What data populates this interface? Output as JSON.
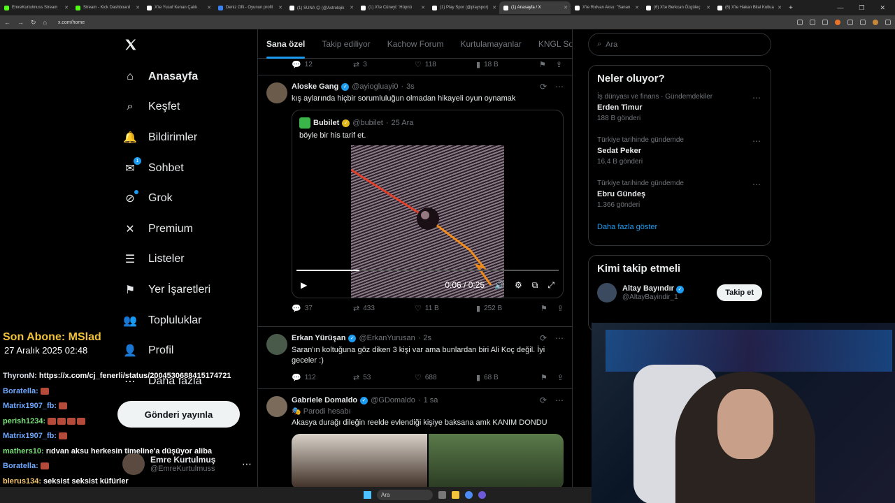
{
  "browser": {
    "tabs": [
      {
        "label": "EmreKurtulmuss Stream",
        "color": "#53fc18",
        "active": false
      },
      {
        "label": "Stream - Kick Dashboard",
        "color": "#53fc18",
        "active": false
      },
      {
        "label": "X'te Yusuf Kenan Çalık",
        "color": "#ffffff",
        "active": false
      },
      {
        "label": "Deniz Ofli - Oyunun profil",
        "color": "#3b82f6",
        "active": false
      },
      {
        "label": "(1) SUNA 😊 (@Astrolojik",
        "color": "#ffffff",
        "active": false
      },
      {
        "label": "(1) X'te Cüneyt: 'Hüpnü",
        "color": "#ffffff",
        "active": false
      },
      {
        "label": "(1) Play Spor (@playspor)",
        "color": "#ffffff",
        "active": false
      },
      {
        "label": "(1) Anasayfa / X",
        "color": "#ffffff",
        "active": true
      },
      {
        "label": "X'te Rıdvan Aksu: \"Sanan",
        "color": "#ffffff",
        "active": false
      },
      {
        "label": "(6) X'te Berkcan Özgüleç",
        "color": "#ffffff",
        "active": false
      },
      {
        "label": "(6) X'te Hakan Bilal Kutlua",
        "color": "#ffffff",
        "active": false
      }
    ],
    "url": "x.com/home"
  },
  "sidebar": {
    "items": [
      {
        "label": "Anasayfa",
        "icon": "home-icon",
        "bold": true
      },
      {
        "label": "Keşfet",
        "icon": "search-icon",
        "bold": false
      },
      {
        "label": "Bildirimler",
        "icon": "bell-icon",
        "bold": false
      },
      {
        "label": "Sohbet",
        "icon": "mail-icon",
        "bold": false,
        "badge": "1"
      },
      {
        "label": "Grok",
        "icon": "grok-icon",
        "bold": false
      },
      {
        "label": "Premium",
        "icon": "x-icon",
        "bold": false
      },
      {
        "label": "Listeler",
        "icon": "list-icon",
        "bold": false
      },
      {
        "label": "Yer İşaretleri",
        "icon": "bookmark-icon",
        "bold": false
      },
      {
        "label": "Topluluklar",
        "icon": "community-icon",
        "bold": false
      },
      {
        "label": "Profil",
        "icon": "person-icon",
        "bold": false
      },
      {
        "label": "Daha fazla",
        "icon": "more-icon",
        "bold": false
      }
    ],
    "post_button": "Gönderi yayınla",
    "account": {
      "name": "Emre Kurtulmuş",
      "handle": "@EmreKurtulmuss"
    }
  },
  "timeline": {
    "tabs": [
      "Sana özel",
      "Takip ediliyor",
      "Kachow Forum",
      "Kurtulamayanlar",
      "KNGL Soc"
    ],
    "prev_tweet_stats": {
      "replies": "12",
      "reposts": "3",
      "likes": "118",
      "views": "18 B"
    },
    "tweets": [
      {
        "name": "Aloske Gang",
        "handle": "@ayiogluayi0",
        "time": "3s",
        "text": "kış aylarında hiçbir sorumluluğun olmadan hikayeli oyun oynamak",
        "quote": {
          "name": "Bubilet",
          "handle": "@bubilet",
          "time": "25 Ara",
          "text": "böyle bir his tarif et.",
          "video_time": "0:06 / 0:25",
          "progress": 0.24
        },
        "stats": {
          "replies": "37",
          "reposts": "433",
          "likes": "11 B",
          "views": "252 B"
        }
      },
      {
        "name": "Erkan Yürüşan",
        "handle": "@ErkanYurusan",
        "time": "2s",
        "text": "Saran'ın koltuğuna göz diken 3 kişi var ama bunlardan biri Ali Koç değil. İyi geceler :)",
        "stats": {
          "replies": "112",
          "reposts": "53",
          "likes": "688",
          "views": "68 B"
        }
      },
      {
        "name": "Gabriele Domaldo",
        "handle": "@GDomaldo",
        "time": "1 sa",
        "parody": "Parodi hesabı",
        "text": "Akasya durağı dileğin reelde evlendiği kişiye baksana amk KANIM DONDU"
      }
    ]
  },
  "right": {
    "search_placeholder": "Ara",
    "trends_title": "Neler oluyor?",
    "trends": [
      {
        "category": "İş dünyası ve finans · Gündemdekiler",
        "title": "Erden Timur",
        "count": "188 B gönderi"
      },
      {
        "category": "Türkiye tarihinde gündemde",
        "title": "Sedat Peker",
        "count": "16,4 B gönderi"
      },
      {
        "category": "Türkiye tarihinde gündemde",
        "title": "Ebru Gündeş",
        "count": "1.366 gönderi"
      }
    ],
    "show_more": "Daha fazla göster",
    "who_title": "Kimi takip etmeli",
    "who": [
      {
        "name": "Altay Bayındır",
        "handle": "@AltayBayindir_1",
        "button": "Takip et"
      }
    ]
  },
  "overlay": {
    "title": "Son Abone: MSlad",
    "date": "27 Aralık 2025   02:48",
    "chat": [
      {
        "user": "ThyronN:",
        "msg": "https://x.com/cj_fenerli/status/2004530688415174721",
        "color": "#d7dde8"
      },
      {
        "user": "Boratella:",
        "msg": "",
        "color": "#6fa8ff",
        "emotes": 1
      },
      {
        "user": "Matrix1907_fb:",
        "msg": "",
        "color": "#6fa8ff",
        "emotes": 1
      },
      {
        "user": "perish1234:",
        "msg": "",
        "color": "#7be07b",
        "emotes": 4
      },
      {
        "user": "Matrix1907_fb:",
        "msg": "",
        "color": "#6fa8ff",
        "emotes": 1
      },
      {
        "user": "mathers10:",
        "msg": "rıdvan aksu herkesin timeline'a düşüyor aliba",
        "color": "#7be07b"
      },
      {
        "user": "Boratella:",
        "msg": "",
        "color": "#6fa8ff",
        "emotes": 1
      },
      {
        "user": "blerus134:",
        "msg": "seksist seksist küfürler",
        "color": "#f7c873"
      }
    ]
  },
  "taskbar": {
    "search": "Ara"
  },
  "colors": {
    "accent": "#1d9bf0",
    "background": "#000000",
    "border": "#2f3336",
    "muted": "#71767b"
  }
}
